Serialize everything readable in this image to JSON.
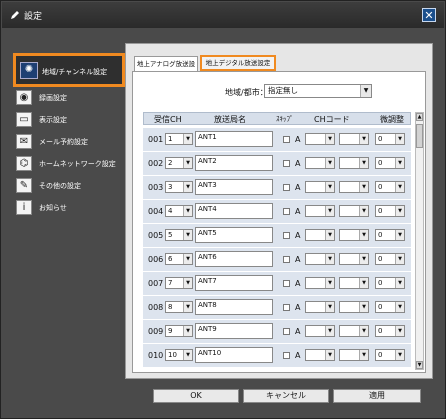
{
  "window": {
    "title": "設定",
    "close_glyph": "✕"
  },
  "sidebar": {
    "items": [
      {
        "label": "地域/チャンネル設定",
        "icon": "satellite-icon",
        "glyph": "✺",
        "active": true
      },
      {
        "label": "録画設定",
        "icon": "record-icon",
        "glyph": "◉"
      },
      {
        "label": "表示設定",
        "icon": "display-icon",
        "glyph": "▭"
      },
      {
        "label": "メール予約設定",
        "icon": "mail-icon",
        "glyph": "✉"
      },
      {
        "label": "ホームネットワーク設定",
        "icon": "network-icon",
        "glyph": "⌬"
      },
      {
        "label": "その他の設定",
        "icon": "wrench-icon",
        "glyph": "✎"
      },
      {
        "label": "お知らせ",
        "icon": "info-icon",
        "glyph": "i"
      }
    ]
  },
  "tabs": {
    "analog": "地上アナログ放送設定",
    "digital": "地上デジタル放送設定"
  },
  "region": {
    "label": "地域/都市：",
    "value": "指定無し"
  },
  "table": {
    "headers": {
      "ch": "受信CH",
      "station": "放送局名",
      "skip": "ｽｷｯﾌﾟ",
      "code": "CHコード",
      "fine": "微調整"
    },
    "rows": [
      {
        "num": "001",
        "ch": "1",
        "name": "ANT1",
        "a": "A",
        "fine": "0"
      },
      {
        "num": "002",
        "ch": "2",
        "name": "ANT2",
        "a": "A",
        "fine": "0"
      },
      {
        "num": "003",
        "ch": "3",
        "name": "ANT3",
        "a": "A",
        "fine": "0"
      },
      {
        "num": "004",
        "ch": "4",
        "name": "ANT4",
        "a": "A",
        "fine": "0"
      },
      {
        "num": "005",
        "ch": "5",
        "name": "ANT5",
        "a": "A",
        "fine": "0"
      },
      {
        "num": "006",
        "ch": "6",
        "name": "ANT6",
        "a": "A",
        "fine": "0"
      },
      {
        "num": "007",
        "ch": "7",
        "name": "ANT7",
        "a": "A",
        "fine": "0"
      },
      {
        "num": "008",
        "ch": "8",
        "name": "ANT8",
        "a": "A",
        "fine": "0"
      },
      {
        "num": "009",
        "ch": "9",
        "name": "ANT9",
        "a": "A",
        "fine": "0"
      },
      {
        "num": "010",
        "ch": "10",
        "name": "ANT10",
        "a": "A",
        "fine": "0"
      }
    ]
  },
  "buttons": {
    "ok": "OK",
    "cancel": "キャンセル",
    "apply": "適用"
  },
  "colors": {
    "highlight": "#f08a20",
    "header_bg": "#d7dfea",
    "row_bg": "#dde4ee"
  }
}
